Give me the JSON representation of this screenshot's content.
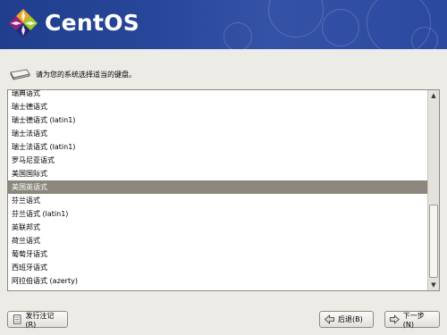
{
  "header": {
    "brand": "CentOS"
  },
  "prompt": {
    "text": "请为您的系统选择适当的键盘。",
    "icon": "keyboard-icon"
  },
  "keyboard_list": {
    "selected": "美国英语式",
    "items": [
      "瑞典语式",
      "瑞士德语式",
      "瑞士德语式 (latin1)",
      "瑞士法语式",
      "瑞士法语式 (latin1)",
      "罗马尼亚语式",
      "美国国际式",
      "美国英语式",
      "芬兰语式",
      "芬兰语式 (latin1)",
      "英联邦式",
      "荷兰语式",
      "葡萄牙语式",
      "西班牙语式",
      "阿拉伯语式 (azerty)"
    ]
  },
  "buttons": {
    "release_notes": "发行注记(R)",
    "back": "后退(B)",
    "next": "下一步(N)"
  },
  "colors": {
    "header": "#2b4a9f",
    "selection": "#8b877c",
    "background": "#ecebe6"
  }
}
